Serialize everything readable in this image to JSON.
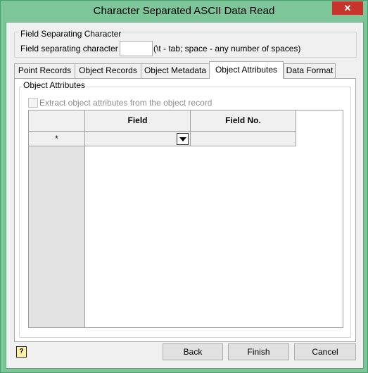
{
  "window": {
    "title": "Character Separated ASCII Data Read",
    "close_label": "✕"
  },
  "field_separating": {
    "group_label": "Field Separating Character",
    "label": "Field separating character",
    "value": "",
    "hint": "(\\t - tab; space - any number of spaces)"
  },
  "tabs": [
    {
      "label": "Point Records"
    },
    {
      "label": "Object Records"
    },
    {
      "label": "Object Metadata"
    },
    {
      "label": "Object Attributes"
    },
    {
      "label": "Data Format"
    }
  ],
  "object_attributes": {
    "group_label": "Object Attributes",
    "extract_label": "Extract object attributes from the object record",
    "grid": {
      "columns": [
        "Field",
        "Field No."
      ],
      "rows": [
        {
          "marker": "*",
          "field": "",
          "field_no": ""
        }
      ]
    }
  },
  "buttons": {
    "back": "Back",
    "finish": "Finish",
    "cancel": "Cancel"
  },
  "help": {
    "icon_text": "?"
  }
}
